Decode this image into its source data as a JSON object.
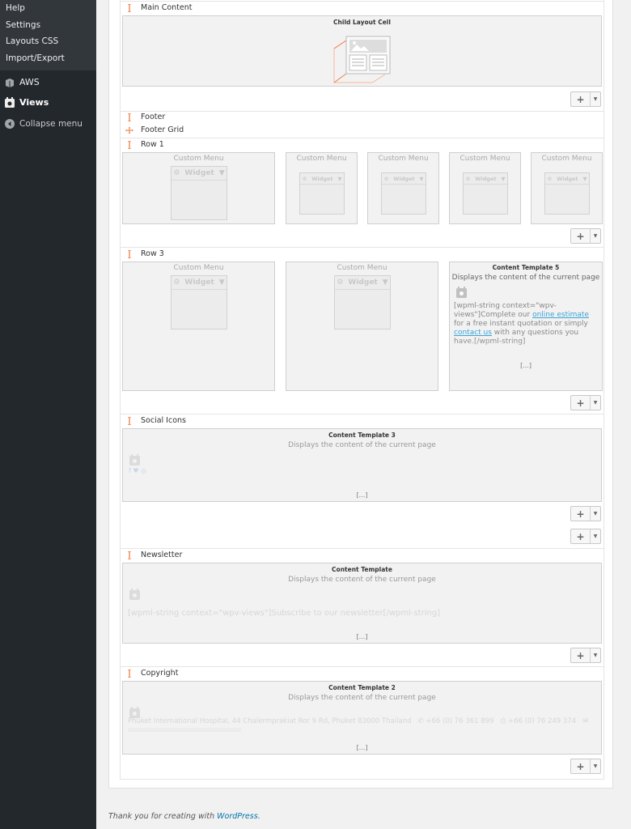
{
  "sidebar": {
    "submenu": [
      "Help",
      "Settings",
      "Layouts CSS",
      "Import/Export"
    ],
    "aws_label": "AWS",
    "views_label": "Views",
    "collapse_label": "Collapse menu"
  },
  "rows": {
    "main_content": "Main Content",
    "footer": "Footer",
    "footer_grid": "Footer Grid",
    "row1": "Row 1",
    "row3": "Row 3",
    "social_icons": "Social Icons",
    "newsletter": "Newsletter",
    "copyright": "Copyright"
  },
  "child_layout": {
    "title": "Child Layout Cell"
  },
  "widget": {
    "custom_menu": "Custom Menu",
    "label": "Widget"
  },
  "templates": {
    "subtitle": "Displays the content of the current page",
    "ellipsis": "[...]",
    "ct5": {
      "title": "Content Template 5",
      "before": "[wpml-string context=\"wpv-views\"]Complete our ",
      "link1": "online estimate",
      "middle": " for a free instant quotation or simply ",
      "link2": "contact us",
      "after": " with any questions you have.[/wpml-string]"
    },
    "ct3": {
      "title": "Content Template 3"
    },
    "ct": {
      "title": "Content Template",
      "text": "[wpml-string context=\"wpv-views\"]Subscribe to our newsletter[/wpml-string]"
    },
    "ct2": {
      "title": "Content Template 2",
      "line1": "Phuket International Hospital, 44 Chalermprakiat Ror 9 Rd, Phuket 83000 Thailand",
      "phone": "+66 (0) 76 361 899",
      "fax": "+66 (0) 76 249 374"
    }
  },
  "buttons": {
    "plus": "+",
    "caret": "▼"
  },
  "footer": {
    "text": "Thank you for creating with ",
    "link": "WordPress",
    "end": "."
  },
  "colors": {
    "accent": "#f07e45",
    "sidebar_bg": "#23282d",
    "link": "#0073aa"
  }
}
